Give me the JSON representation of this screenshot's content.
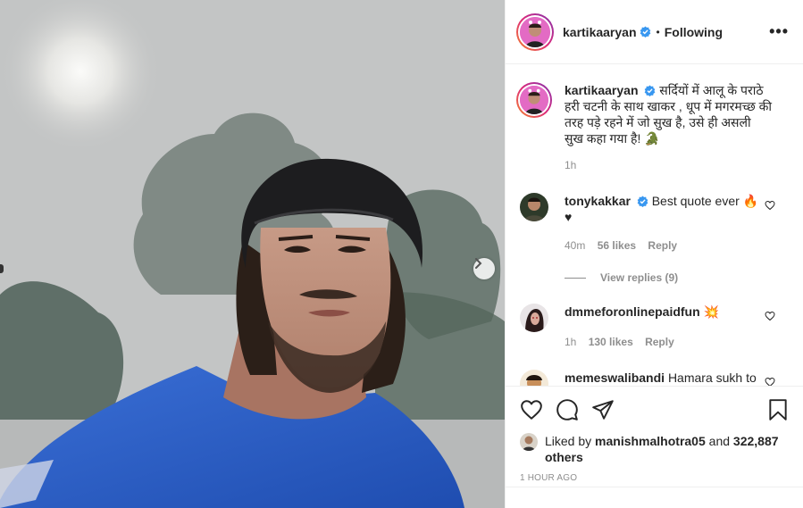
{
  "post": {
    "author": "kartikaaryan",
    "follow_status": "Following",
    "more_label": "•••",
    "caption": "सर्दियों में आलू के पराठे हरी चटनी के साथ खाकर , धूप में मगरमच्छ की तरह पड़े रहने में जो सुख है, उसे ही असली सुख कहा गया है! 🐊",
    "caption_time": "1h",
    "comments": [
      {
        "user": "tonykakkar",
        "verified": true,
        "text": "Best quote ever 🔥 ♥",
        "time": "40m",
        "likes": "56 likes",
        "reply": "Reply",
        "view_replies": "View replies (9)"
      },
      {
        "user": "dmmeforonlinepaidfun",
        "verified": false,
        "text": "💥",
        "time": "1h",
        "likes": "130 likes",
        "reply": "Reply"
      },
      {
        "user": "memeswalibandi",
        "verified": false,
        "text": "Hamara sukh to"
      }
    ],
    "liked_by_prefix": "Liked by",
    "liked_by_user": "manishmalhotra05",
    "liked_by_and": "and",
    "liked_count": "322,887 others",
    "post_age": "1 HOUR AGO"
  },
  "icons": {
    "verified": "verified-badge-icon",
    "like": "heart-icon",
    "comment": "comment-icon",
    "share": "paper-plane-icon",
    "save": "bookmark-icon",
    "next": "chevron-right-icon"
  },
  "colors": {
    "verified": "#3897f0",
    "text": "#262626",
    "muted": "#8e8e8e",
    "divider": "#efefef",
    "story_ring_start": "#f58529",
    "story_ring_end": "#8134af",
    "shirt": "#2a5cc4"
  }
}
